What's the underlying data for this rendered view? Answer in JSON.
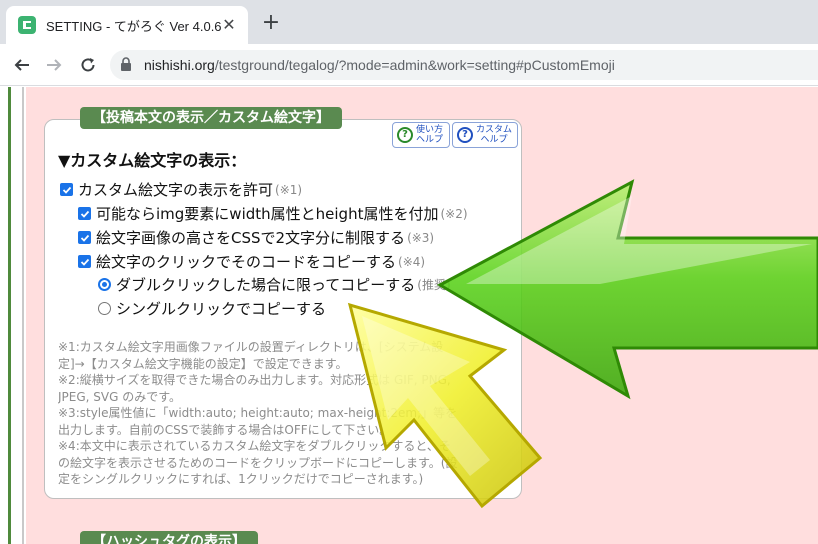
{
  "browser": {
    "tab_title": "SETTING - てがろぐ Ver 4.0.6",
    "close_glyph": "✕",
    "new_tab_glyph": "+",
    "url_host": "nishishi.org",
    "url_path": "/testground/tegalog/?mode=admin&work=setting#pCustomEmoji"
  },
  "section": {
    "title": "【投稿本文の表示／カスタム絵文字】",
    "next_title": "【ハッシュタグの表示】"
  },
  "help": {
    "usage_label_1": "使い方",
    "usage_label_2": "ヘルプ",
    "custom_label_1": "カスタム",
    "custom_label_2": "ヘルプ",
    "q_glyph": "?"
  },
  "settings": {
    "heading": "▼カスタム絵文字の表示：",
    "allow": {
      "label": "カスタム絵文字の表示を許可",
      "note": "(※1)",
      "checked": true
    },
    "img_attr": {
      "label": "可能ならimg要素にwidth属性とheight属性を付加",
      "note": "(※2)",
      "checked": true
    },
    "limit_height": {
      "label": "絵文字画像の高さをCSSで2文字分に制限する",
      "note": "(※3)",
      "checked": true
    },
    "copy_code": {
      "label": "絵文字のクリックでそのコードをコピーする",
      "note": "(※4)",
      "checked": true
    },
    "double_click": {
      "label": "ダブルクリックした場合に限ってコピーする",
      "note": "(推奨)",
      "selected": true
    },
    "single_click": {
      "label": "シングルクリックでコピーする",
      "selected": false
    }
  },
  "notes": [
    "※1:カスタム絵文字用画像ファイルの設置ディレクトリは、[システム設",
    "定]→【カスタム絵文字機能の設定】で設定できます。",
    "※2:縦横サイズを取得できた場合のみ出力します。対応形式は GIF, PNG,",
    "JPEG, SVG のみです。",
    "※3:style属性値に「width:auto; height:auto; max-height:2em;」等を",
    "出力します。自前のCSSで装飾する場合はOFFにして下さい。",
    "※4:本文中に表示されているカスタム絵文字をダブルクリックすると、そ",
    "の絵文字を表示させるためのコードをクリップボードにコピーします。(設",
    "定をシングルクリックにすれば、1クリックだけでコピーされます。)"
  ],
  "colors": {
    "page_bg": "#ffdede",
    "section_bg": "#5a8a50",
    "checkbox": "#1a73e8",
    "arrow_green": "#5ad21a",
    "arrow_yellow": "#f0ef2a"
  }
}
